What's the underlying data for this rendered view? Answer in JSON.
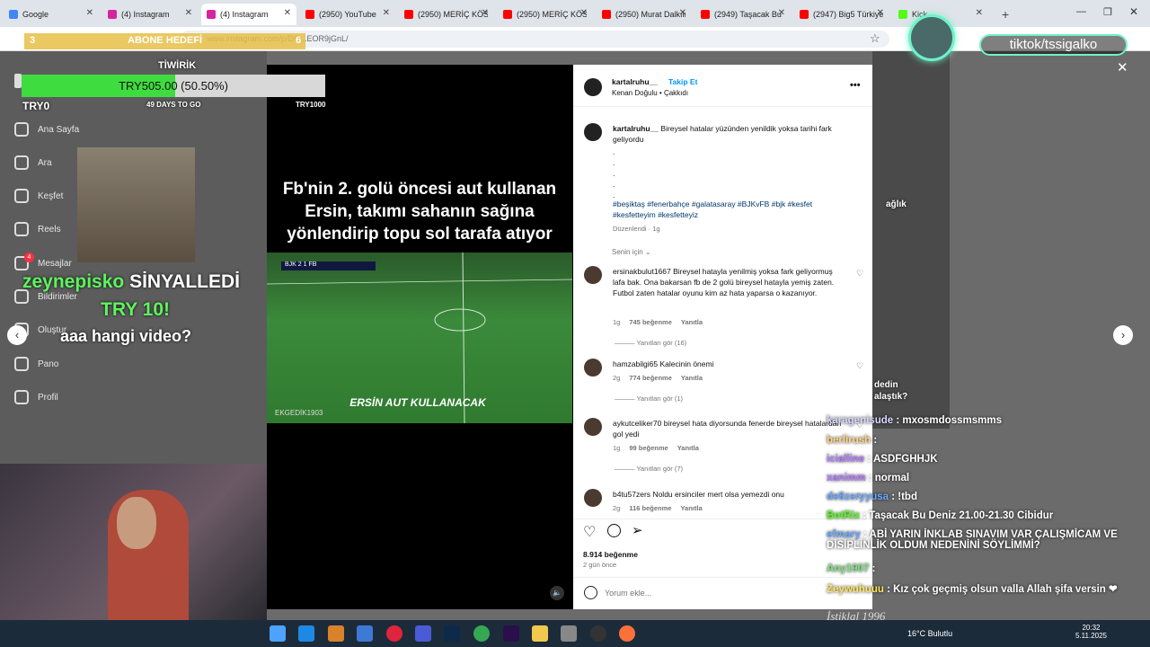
{
  "browser": {
    "tabs": [
      {
        "label": "Google",
        "color": "#4285f4"
      },
      {
        "label": "(4) Instagram",
        "color": "#d6249f"
      },
      {
        "label": "(4) Instagram",
        "color": "#d6249f"
      },
      {
        "label": "(2950) YouTube",
        "color": "#ff0000"
      },
      {
        "label": "(2950) MERİÇ KÖSE |",
        "color": "#ff0000"
      },
      {
        "label": "(2950) MERİÇ KÖSE |",
        "color": "#ff0000"
      },
      {
        "label": "(2950) Murat Dalkılıç",
        "color": "#ff0000"
      },
      {
        "label": "(2949) Taşacak Bu De",
        "color": "#ff0000"
      },
      {
        "label": "(2947) Big5 Türkiye |",
        "color": "#ff0000"
      },
      {
        "label": "Kick",
        "color": "#53fc18"
      }
    ],
    "url": "www.instagram.com/p/DQ...EOR9jGnL/"
  },
  "ig_nav": {
    "items": [
      "Ana Sayfa",
      "Ara",
      "Keşfet",
      "Reels",
      "Mesajlar",
      "Bildirimler",
      "Oluştur",
      "Pano",
      "Profil"
    ],
    "messages_badge": "4"
  },
  "video": {
    "title": "Fb'nin 2. golü öncesi aut kullanan Ersin, takımı sahanın sağına yönlendirip topu sol tarafa atıyor",
    "scoreboard": "BJK 2 1 FB",
    "caption": "ERSİN AUT KULLANACAK",
    "watermark": "EKGEDİK1903"
  },
  "post": {
    "username": "kartalruhu__",
    "follow": "Takip Et",
    "audio": "Kenan Doğulu • Çakkıdı",
    "caption_user": "kartalruhu__",
    "caption_text": "Bireysel hatalar yüzünden yenildik yoksa tarihi fark geliyordu",
    "dots": [
      ".",
      ".",
      ".",
      ".",
      "."
    ],
    "hashtags": "#beşiktaş #fenerbahçe #galatasaray #BJKvFB #bjk #kesfet #kesfetteyim #kesfetteyiz",
    "edited": "Düzenlendi · 1g",
    "sort": "Senin için",
    "comments": [
      {
        "user": "ersinakbulut1667",
        "text": "Bireysel hatayla yenilmiş yoksa fark geliyormuş lafa bak. Ona bakarsan fb de 2 golü bireysel hatayla yemiş zaten. Futbol zaten hatalar oyunu kim az hata yaparsa o kazanıyor.",
        "age": "1g",
        "likes": "745 beğenme",
        "reply": "Yanıtla",
        "replies": "Yanıtları gör (16)"
      },
      {
        "user": "hamzabilgi65",
        "text": "Kalecinin önemi",
        "age": "2g",
        "likes": "774 beğenme",
        "reply": "Yanıtla",
        "replies": "Yanıtları gör (1)"
      },
      {
        "user": "aykutceliker70",
        "text": "bireysel hata diyorsunda fenerde bireysel hatalardan gol yedi",
        "age": "1g",
        "likes": "99 beğenme",
        "reply": "Yanıtla",
        "replies": "Yanıtları gör (7)"
      },
      {
        "user": "b4tu57zers",
        "text": "Noldu ersinciler mert olsa yemezdi onu",
        "age": "2g",
        "likes": "116 beğenme",
        "reply": "Yanıtla",
        "replies": ""
      }
    ],
    "likes": "8.914 beğenme",
    "posted": "2 gün önce",
    "comment_placeholder": "Yorum ekle..."
  },
  "overlay": {
    "sub_goal_left": "3",
    "sub_goal_label": "ABONE HEDEFİ",
    "sub_goal_right": "6",
    "tiwirik": "TİWİRİK",
    "donation": "TRY505.00 (50.50%)",
    "donation_progress": 50.5,
    "donation_min": "TRY0",
    "days_left": "49 DAYS TO GO",
    "donation_max": "TRY1000",
    "alert_user": "zeynepisko",
    "alert_action": "SİNYALLEDİ",
    "alert_amount": "TRY 10!",
    "alert_message": "aaa hangi video?",
    "tiktok": "tiktok/tssigalko",
    "thumb_text_1": "ağlık",
    "thumb_text_2": "dedin",
    "thumb_text_3": "alaştık?",
    "bottom_banner": "İstiklal 1996"
  },
  "chat": [
    {
      "user": "karagenisude",
      "msg": ": mxosmdossmsmms",
      "color": "#d6d6ff"
    },
    {
      "user": "berlirush",
      "msg": ":",
      "color": "#ffd27f"
    },
    {
      "user": "icialline",
      "msg": ": ASDFGHHJK",
      "color": "#b57cff"
    },
    {
      "user": "xanimm",
      "msg": ": normal",
      "color": "#b57cff"
    },
    {
      "user": "de8zeryyusa",
      "msg": ": !tbd",
      "color": "#6aa8ff"
    },
    {
      "user": "BotRix",
      "msg": ": Taşacak Bu Deniz 21.00-21.30 Cibidur",
      "color": "#53fc18"
    },
    {
      "user": "efmary",
      "msg": ": ABİ YARIN İNKLAB SINAVIM VAR ÇALIŞMİCAM VE DİSİPLİNLİK OLDUM NEDENİNİ SÖYLİMMİ?",
      "color": "#6aa8ff"
    },
    {
      "user": "Any1907",
      "msg": ":",
      "color": "#7fe07f"
    },
    {
      "user": "Zeywuhuuu",
      "msg": ": Kız çok geçmiş olsun valla Allah şifa versin ❤",
      "color": "#ffe45c"
    }
  ],
  "taskbar": {
    "weather": "16°C  Bulutlu",
    "time": "20:32",
    "date": "5.11.2025"
  }
}
